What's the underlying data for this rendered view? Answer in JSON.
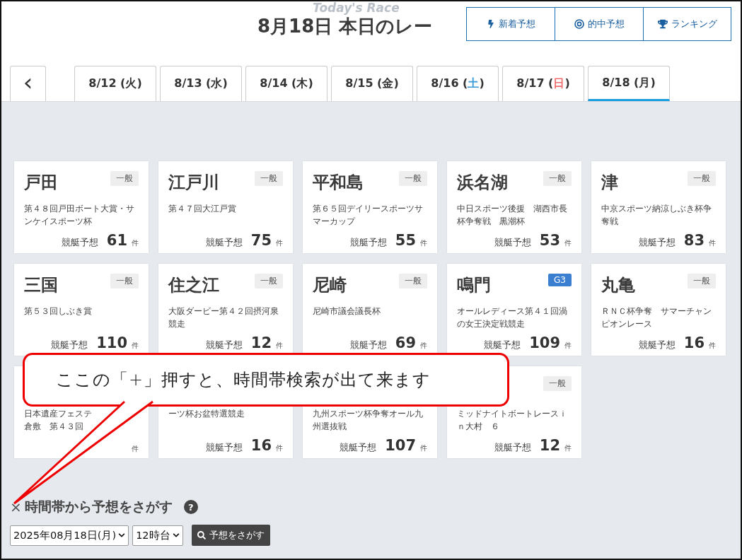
{
  "header": {
    "backdrop_title": "Today's Race",
    "title": "8月18日 本日のレー",
    "nav": [
      {
        "label": "新着予想"
      },
      {
        "label": "的中予想"
      },
      {
        "label": "ランキング"
      }
    ]
  },
  "back_label": "‹",
  "tabs": [
    {
      "before": "8/12 (",
      "weekday": "火",
      "after": ")",
      "selected": false
    },
    {
      "before": "8/13 (",
      "weekday": "水",
      "after": ")",
      "selected": false
    },
    {
      "before": "8/14 (",
      "weekday": "木",
      "after": ")",
      "selected": false
    },
    {
      "before": "8/15 (",
      "weekday": "金",
      "after": ")",
      "selected": false
    },
    {
      "before": "8/16 (",
      "weekday": "土",
      "after": ")",
      "color": "#3a9bd9",
      "selected": false
    },
    {
      "before": "8/17 (",
      "weekday": "日",
      "after": ")",
      "color": "#f07070",
      "selected": false
    },
    {
      "before": "8/18 (",
      "weekday": "月",
      "after": ")",
      "selected": true
    }
  ],
  "venues": [
    {
      "name": "戸田",
      "grade": "一般",
      "kind": "normal",
      "lines": [
        "第４８回戸田ボート大賞・サ",
        "ンケイスポーツ杯"
      ],
      "label": "競艇予想",
      "count": "61",
      "unit": "件"
    },
    {
      "name": "江戸川",
      "grade": "一般",
      "kind": "normal",
      "lines": [
        "第４７回大江戸賞"
      ],
      "label": "競艇予想",
      "count": "75",
      "unit": "件"
    },
    {
      "name": "平和島",
      "grade": "一般",
      "kind": "normal",
      "lines": [
        "第６５回デイリースポーツサ",
        "マーカップ"
      ],
      "label": "競艇予想",
      "count": "55",
      "unit": "件"
    },
    {
      "name": "浜名湖",
      "grade": "一般",
      "kind": "normal",
      "lines": [
        "中日スポーツ後援　湖西市長",
        "杯争奪戦　黒潮杯"
      ],
      "label": "競艇予想",
      "count": "53",
      "unit": "件"
    },
    {
      "name": "津",
      "grade": "一般",
      "kind": "normal",
      "lines": [
        "中京スポーツ納涼しぶき杯争",
        "奪戦"
      ],
      "label": "競艇予想",
      "count": "83",
      "unit": "件"
    },
    {
      "name": "三国",
      "grade": "一般",
      "kind": "normal",
      "lines": [
        "第５３回しぶき賞"
      ],
      "label": "競艇予想",
      "count": "110",
      "unit": "件"
    },
    {
      "name": "住之江",
      "grade": "一般",
      "kind": "normal",
      "lines": [
        "大阪ダービー第４２回摂河泉",
        "競走"
      ],
      "label": "競艇予想",
      "count": "12",
      "unit": "件"
    },
    {
      "name": "尼崎",
      "grade": "一般",
      "kind": "normal",
      "lines": [
        "尼崎市議会議長杯"
      ],
      "label": "競艇予想",
      "count": "69",
      "unit": "件"
    },
    {
      "name": "鳴門",
      "grade": "G3",
      "kind": "graded",
      "lines": [
        "オールレディース第４１回渦",
        "の女王決定戦競走"
      ],
      "label": "競艇予想",
      "count": "109",
      "unit": "件"
    },
    {
      "name": "丸亀",
      "grade": "一般",
      "kind": "normal",
      "lines": [
        "ＲＮＣ杯争奪　サマーチャン",
        "ピオンレース"
      ],
      "label": "競艇予想",
      "count": "16",
      "unit": "件"
    },
    {
      "lines": [
        "日本遺産フェステ",
        "倉敷　第４３回"
      ],
      "unit": "件"
    },
    {
      "lines": [
        "ーツ杯お盆特選競走"
      ],
      "label": "競艇予想",
      "count": "16",
      "unit": "件"
    },
    {
      "lines": [
        "九州スポーツ杯争奪オール九",
        "州選抜戦"
      ],
      "label": "競艇予想",
      "count": "107",
      "unit": "件"
    },
    {
      "grade": "一般",
      "kind": "normal",
      "lines": [
        "ミッドナイトボートレースｉ",
        "ｎ大村　６"
      ],
      "label": "競艇予想",
      "count": "12",
      "unit": "件"
    }
  ],
  "time_search": {
    "toggle": "×",
    "heading": "時間帯から予想をさがす",
    "help": "?",
    "date_value": "2025年08月18日(月)",
    "hour_value": "12時台",
    "button": "予想をさがす"
  },
  "callout": {
    "text": "ここの「+」押すと、時間帯検索が出て来ます"
  }
}
